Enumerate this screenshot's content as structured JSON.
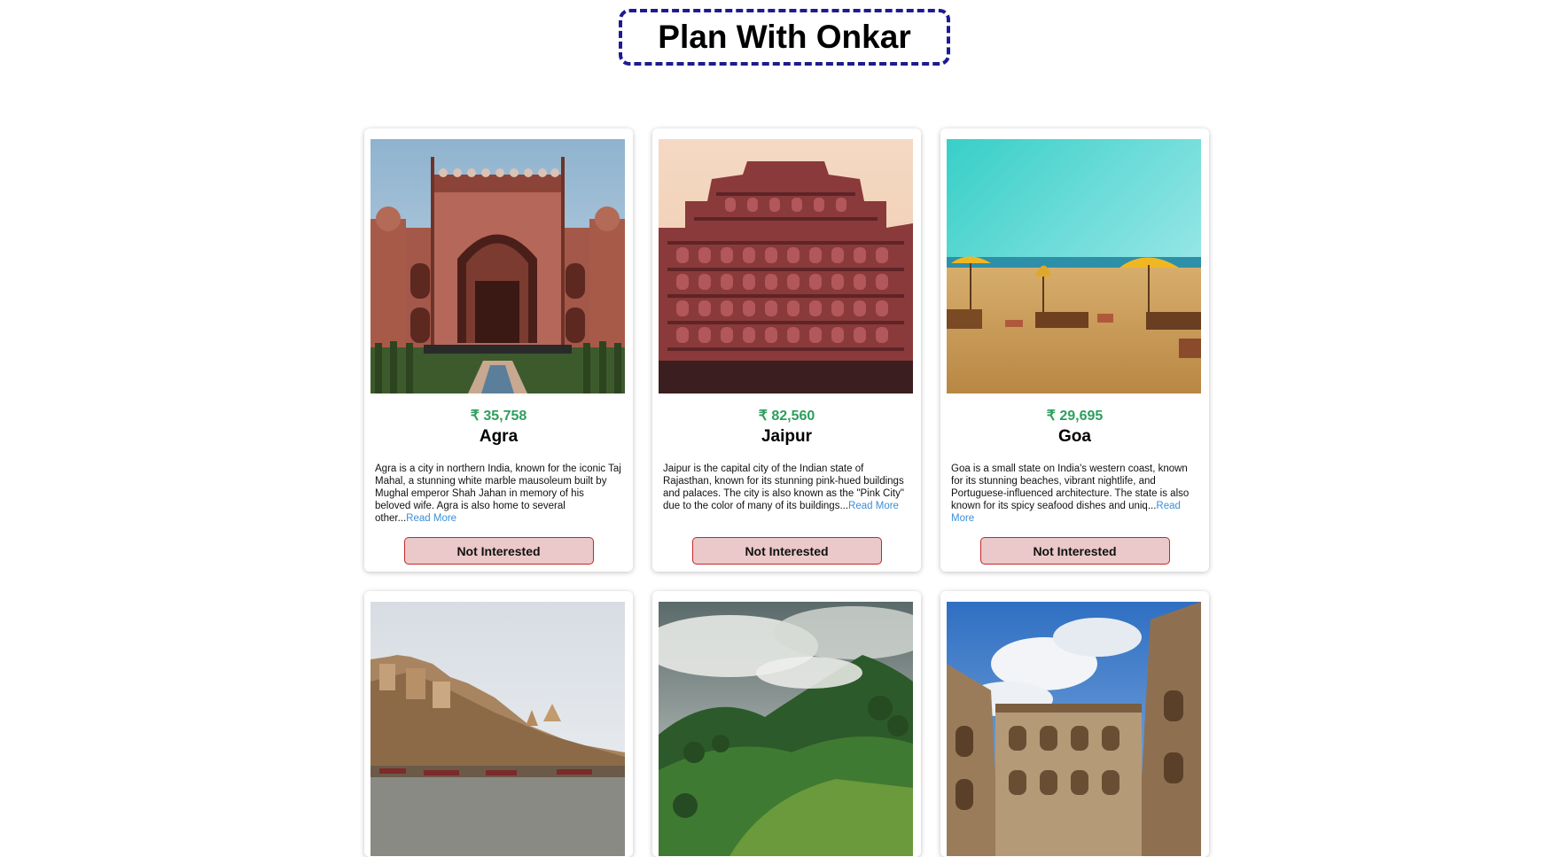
{
  "header": {
    "title": "Plan With Onkar"
  },
  "cards": [
    {
      "price": "₹ 35,758",
      "name": "Agra",
      "description": "Agra is a city in northern India, known for the iconic Taj Mahal, a stunning white marble mausoleum built by Mughal emperor Shah Jahan in memory of his beloved wife. Agra is also home to several other...",
      "read_more": "Read More",
      "button": "Not Interested"
    },
    {
      "price": "₹ 82,560",
      "name": "Jaipur",
      "description": "Jaipur is the capital city of the Indian state of Rajasthan, known for its stunning pink-hued buildings and palaces. The city is also known as the \"Pink City\" due to the color of many of its buildings...",
      "read_more": "Read More",
      "button": "Not Interested"
    },
    {
      "price": "₹ 29,695",
      "name": "Goa",
      "description": "Goa is a small state on India's western coast, known for its stunning beaches, vibrant nightlife, and Portuguese-influenced architecture. The state is also known for its spicy seafood dishes and uniq...",
      "read_more": "Read More",
      "button": "Not Interested"
    }
  ],
  "colors": {
    "title_border": "#1d1a94",
    "price": "#2e9e5c",
    "read_more": "#3a8fd8",
    "button_bg": "#ebc8c9",
    "button_border": "#c0292b"
  }
}
